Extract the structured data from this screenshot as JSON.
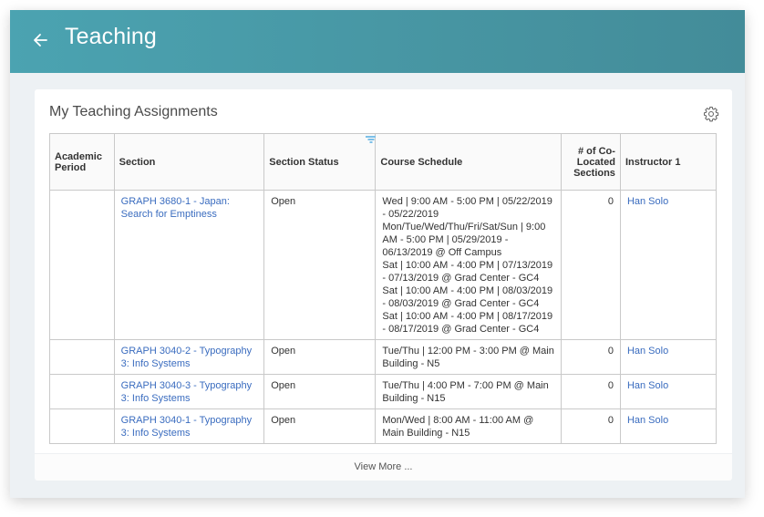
{
  "header": {
    "title": "Teaching",
    "back_icon": "arrow-left-icon",
    "color": "#4795a2"
  },
  "card": {
    "title": "My Teaching Assignments",
    "settings_icon": "gear-icon",
    "view_more_label": "View More ..."
  },
  "table": {
    "columns": [
      {
        "label": "Academic Period"
      },
      {
        "label": "Section"
      },
      {
        "label": "Section Status",
        "filtered": true
      },
      {
        "label": "Course Schedule"
      },
      {
        "label": "# of Co-Located Sections"
      },
      {
        "label": "Instructor 1"
      }
    ],
    "rows": [
      {
        "academic_period": "",
        "section": "GRAPH 3680-1 - Japan: Search for Emptiness",
        "status": "Open",
        "schedule": [
          "Wed | 9:00 AM - 5:00 PM | 05/22/2019 - 05/22/2019",
          "Mon/Tue/Wed/Thu/Fri/Sat/Sun | 9:00 AM - 5:00 PM | 05/29/2019 - 06/13/2019 @ Off Campus",
          "Sat | 10:00 AM - 4:00 PM | 07/13/2019 - 07/13/2019 @ Grad Center - GC4",
          "Sat | 10:00 AM - 4:00 PM | 08/03/2019 - 08/03/2019 @ Grad Center - GC4",
          "Sat | 10:00 AM - 4:00 PM | 08/17/2019 - 08/17/2019 @ Grad Center - GC4"
        ],
        "co_located": "0",
        "instructor": "Han Solo"
      },
      {
        "academic_period": "",
        "section": "GRAPH 3040-2 - Typography 3: Info Systems",
        "status": "Open",
        "schedule": [
          "Tue/Thu | 12:00 PM - 3:00 PM @ Main Building - N5"
        ],
        "co_located": "0",
        "instructor": "Han Solo"
      },
      {
        "academic_period": "",
        "section": "GRAPH 3040-3 - Typography 3: Info Systems",
        "status": "Open",
        "schedule": [
          "Tue/Thu | 4:00 PM - 7:00 PM @ Main Building - N15"
        ],
        "co_located": "0",
        "instructor": "Han Solo"
      },
      {
        "academic_period": "",
        "section": "GRAPH 3040-1 - Typography 3: Info Systems",
        "status": "Open",
        "schedule": [
          "Mon/Wed | 8:00 AM - 11:00 AM @ Main Building - N15"
        ],
        "co_located": "0",
        "instructor": "Han Solo"
      }
    ]
  }
}
